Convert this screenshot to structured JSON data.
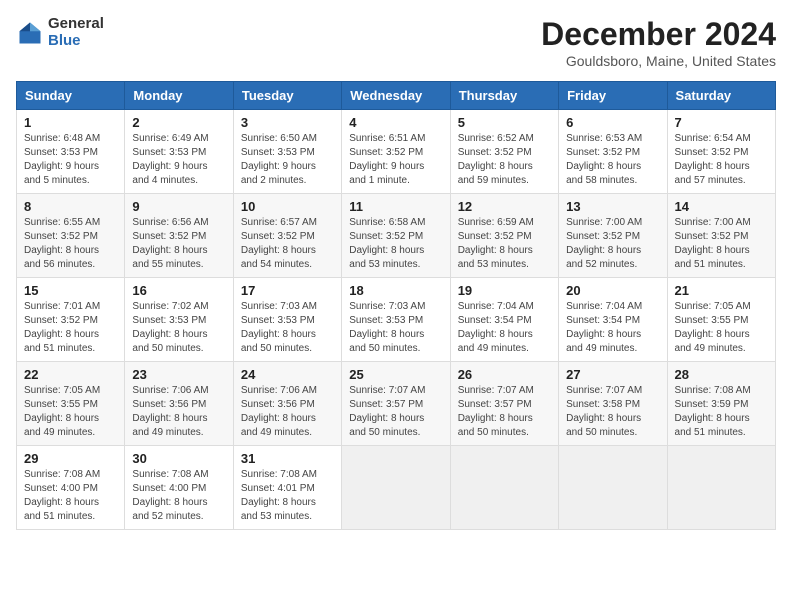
{
  "logo": {
    "general": "General",
    "blue": "Blue"
  },
  "header": {
    "title": "December 2024",
    "subtitle": "Gouldsboro, Maine, United States"
  },
  "weekdays": [
    "Sunday",
    "Monday",
    "Tuesday",
    "Wednesday",
    "Thursday",
    "Friday",
    "Saturday"
  ],
  "weeks": [
    [
      {
        "day": "1",
        "sunrise": "6:48 AM",
        "sunset": "3:53 PM",
        "daylight": "9 hours and 5 minutes."
      },
      {
        "day": "2",
        "sunrise": "6:49 AM",
        "sunset": "3:53 PM",
        "daylight": "9 hours and 4 minutes."
      },
      {
        "day": "3",
        "sunrise": "6:50 AM",
        "sunset": "3:53 PM",
        "daylight": "9 hours and 2 minutes."
      },
      {
        "day": "4",
        "sunrise": "6:51 AM",
        "sunset": "3:52 PM",
        "daylight": "9 hours and 1 minute."
      },
      {
        "day": "5",
        "sunrise": "6:52 AM",
        "sunset": "3:52 PM",
        "daylight": "8 hours and 59 minutes."
      },
      {
        "day": "6",
        "sunrise": "6:53 AM",
        "sunset": "3:52 PM",
        "daylight": "8 hours and 58 minutes."
      },
      {
        "day": "7",
        "sunrise": "6:54 AM",
        "sunset": "3:52 PM",
        "daylight": "8 hours and 57 minutes."
      }
    ],
    [
      {
        "day": "8",
        "sunrise": "6:55 AM",
        "sunset": "3:52 PM",
        "daylight": "8 hours and 56 minutes."
      },
      {
        "day": "9",
        "sunrise": "6:56 AM",
        "sunset": "3:52 PM",
        "daylight": "8 hours and 55 minutes."
      },
      {
        "day": "10",
        "sunrise": "6:57 AM",
        "sunset": "3:52 PM",
        "daylight": "8 hours and 54 minutes."
      },
      {
        "day": "11",
        "sunrise": "6:58 AM",
        "sunset": "3:52 PM",
        "daylight": "8 hours and 53 minutes."
      },
      {
        "day": "12",
        "sunrise": "6:59 AM",
        "sunset": "3:52 PM",
        "daylight": "8 hours and 53 minutes."
      },
      {
        "day": "13",
        "sunrise": "7:00 AM",
        "sunset": "3:52 PM",
        "daylight": "8 hours and 52 minutes."
      },
      {
        "day": "14",
        "sunrise": "7:00 AM",
        "sunset": "3:52 PM",
        "daylight": "8 hours and 51 minutes."
      }
    ],
    [
      {
        "day": "15",
        "sunrise": "7:01 AM",
        "sunset": "3:52 PM",
        "daylight": "8 hours and 51 minutes."
      },
      {
        "day": "16",
        "sunrise": "7:02 AM",
        "sunset": "3:53 PM",
        "daylight": "8 hours and 50 minutes."
      },
      {
        "day": "17",
        "sunrise": "7:03 AM",
        "sunset": "3:53 PM",
        "daylight": "8 hours and 50 minutes."
      },
      {
        "day": "18",
        "sunrise": "7:03 AM",
        "sunset": "3:53 PM",
        "daylight": "8 hours and 50 minutes."
      },
      {
        "day": "19",
        "sunrise": "7:04 AM",
        "sunset": "3:54 PM",
        "daylight": "8 hours and 49 minutes."
      },
      {
        "day": "20",
        "sunrise": "7:04 AM",
        "sunset": "3:54 PM",
        "daylight": "8 hours and 49 minutes."
      },
      {
        "day": "21",
        "sunrise": "7:05 AM",
        "sunset": "3:55 PM",
        "daylight": "8 hours and 49 minutes."
      }
    ],
    [
      {
        "day": "22",
        "sunrise": "7:05 AM",
        "sunset": "3:55 PM",
        "daylight": "8 hours and 49 minutes."
      },
      {
        "day": "23",
        "sunrise": "7:06 AM",
        "sunset": "3:56 PM",
        "daylight": "8 hours and 49 minutes."
      },
      {
        "day": "24",
        "sunrise": "7:06 AM",
        "sunset": "3:56 PM",
        "daylight": "8 hours and 49 minutes."
      },
      {
        "day": "25",
        "sunrise": "7:07 AM",
        "sunset": "3:57 PM",
        "daylight": "8 hours and 50 minutes."
      },
      {
        "day": "26",
        "sunrise": "7:07 AM",
        "sunset": "3:57 PM",
        "daylight": "8 hours and 50 minutes."
      },
      {
        "day": "27",
        "sunrise": "7:07 AM",
        "sunset": "3:58 PM",
        "daylight": "8 hours and 50 minutes."
      },
      {
        "day": "28",
        "sunrise": "7:08 AM",
        "sunset": "3:59 PM",
        "daylight": "8 hours and 51 minutes."
      }
    ],
    [
      {
        "day": "29",
        "sunrise": "7:08 AM",
        "sunset": "4:00 PM",
        "daylight": "8 hours and 51 minutes."
      },
      {
        "day": "30",
        "sunrise": "7:08 AM",
        "sunset": "4:00 PM",
        "daylight": "8 hours and 52 minutes."
      },
      {
        "day": "31",
        "sunrise": "7:08 AM",
        "sunset": "4:01 PM",
        "daylight": "8 hours and 53 minutes."
      },
      null,
      null,
      null,
      null
    ]
  ]
}
